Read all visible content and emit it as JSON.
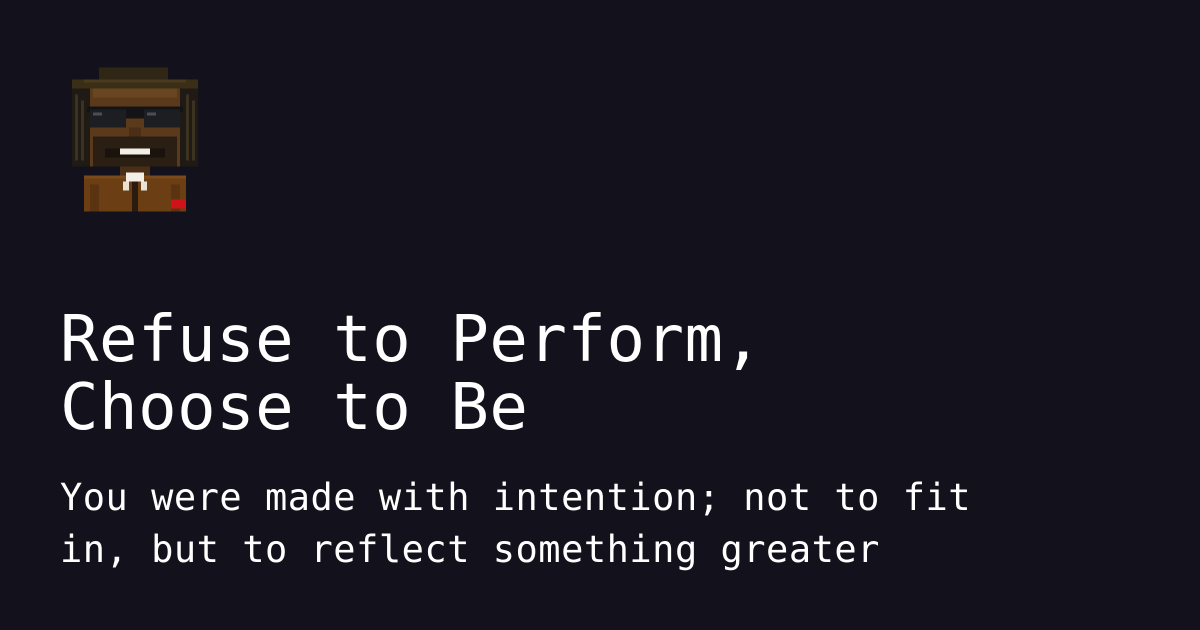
{
  "page": {
    "background_color": "#13111b",
    "text_color": "#ffffff"
  },
  "avatar": {
    "icon": "pixel-art-avatar-icon",
    "description_colors": {
      "hat": "#2f2616",
      "skin": "#5b3a1c",
      "glasses": "#1c1e22",
      "coat": "#6b3e14",
      "accent": "#d0121b"
    }
  },
  "headline": {
    "line1": "Refuse to Perform,",
    "line2": "Choose to Be"
  },
  "subheadline": {
    "line1": "You were made with intention; not to fit",
    "line2": "in, but to reflect something greater"
  }
}
